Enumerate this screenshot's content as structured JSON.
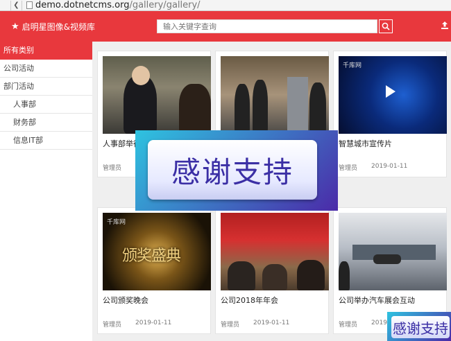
{
  "browser": {
    "url_host": "demo.dotnetcms.org",
    "url_path": "/gallery/gallery/"
  },
  "header": {
    "title": "启明星图像&视频库",
    "search_placeholder": "输入关键字查询"
  },
  "sidebar": {
    "head": "所有类别",
    "items": [
      {
        "label": "公司活动"
      },
      {
        "label": "部门活动"
      },
      {
        "label": "人事部"
      },
      {
        "label": "财务部"
      },
      {
        "label": "信息IT部"
      }
    ]
  },
  "cards": [
    {
      "title": "人事部举行招聘会",
      "author": "管理员",
      "date": ""
    },
    {
      "title": "",
      "author": "",
      "date": ""
    },
    {
      "title": "智慧城市宣传片",
      "author": "管理员",
      "date": "2019-01-11",
      "thumb_label": "千库网"
    },
    {
      "title": "公司颁奖晚会",
      "author": "管理员",
      "date": "2019-01-11",
      "thumb_label": "千库网",
      "thumb_text": "颁奖盛典"
    },
    {
      "title": "公司2018年年会",
      "author": "管理员",
      "date": "2019-01-11"
    },
    {
      "title": "公司举办汽车展会互动",
      "author": "管理员",
      "date": "2019-01-11"
    }
  ],
  "overlay": {
    "text": "感谢支持"
  }
}
